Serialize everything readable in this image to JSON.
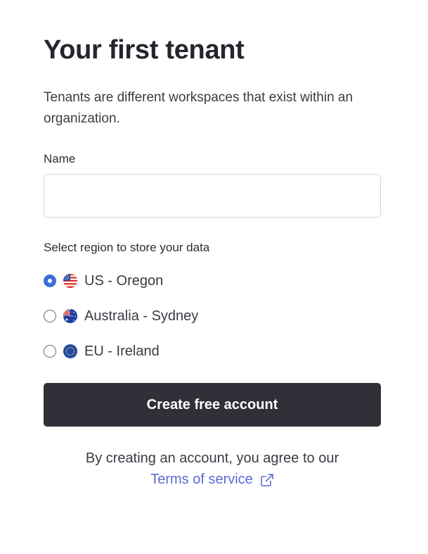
{
  "form": {
    "title": "Your first tenant",
    "description": "Tenants are different workspaces that exist within an organization.",
    "name_label": "Name",
    "name_value": "",
    "region_label": "Select region to store your data",
    "regions": [
      {
        "label": "US - Oregon",
        "flag": "us-flag-icon",
        "selected": true
      },
      {
        "label": "Australia - Sydney",
        "flag": "australia-flag-icon",
        "selected": false
      },
      {
        "label": "EU - Ireland",
        "flag": "eu-flag-icon",
        "selected": false
      }
    ],
    "submit_label": "Create free account",
    "legal_text": "By creating an account, you agree to our",
    "terms_link": "Terms of service",
    "terms_icon": "external-link-icon"
  },
  "colors": {
    "primary_button": "#2f3038",
    "radio_selected": "#3b6fd6",
    "link": "#5b6bd3"
  }
}
